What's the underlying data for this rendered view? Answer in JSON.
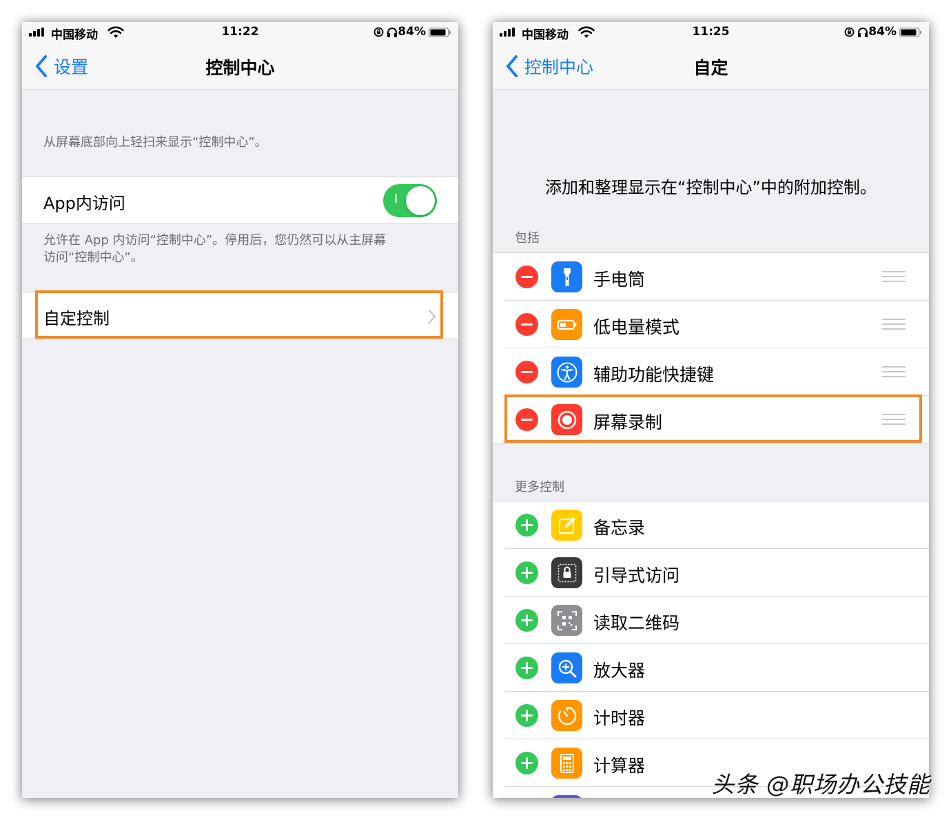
{
  "left": {
    "status": {
      "carrier": "中国移动",
      "time": "11:22",
      "battery": "84%"
    },
    "nav": {
      "back_label": "设置",
      "title": "控制中心"
    },
    "intro_text": "从屏幕底部向上轻扫来显示“控制中心”。",
    "app_access": {
      "label": "App内访问",
      "toggle_glyph": "I",
      "enabled": true
    },
    "app_access_footer_line1": "允许在 App 内访问“控制中心”。停用后，您仍然可以从主屏幕",
    "app_access_footer_line2": "访问“控制中心”。",
    "customize_label": "自定控制"
  },
  "right": {
    "status": {
      "carrier": "中国移动",
      "time": "11:25",
      "battery": "84%"
    },
    "nav": {
      "back_label": "控制中心",
      "title": "自定"
    },
    "description": "添加和整理显示在“控制中心”中的附加控制。",
    "included_header": "包括",
    "included": [
      {
        "label": "手电筒",
        "icon": "flashlight-icon",
        "color": "#1a7cf5"
      },
      {
        "label": "低电量模式",
        "icon": "battery-icon",
        "color": "#ff9500"
      },
      {
        "label": "辅助功能快捷键",
        "icon": "accessibility-icon",
        "color": "#1a7cf5"
      },
      {
        "label": "屏幕录制",
        "icon": "screen-record-icon",
        "color": "#ff3b30"
      }
    ],
    "more_header": "更多控制",
    "more": [
      {
        "label": "备忘录",
        "icon": "notes-icon",
        "color": "#ffcc00"
      },
      {
        "label": "引导式访问",
        "icon": "lock-icon",
        "color": "#3a3a3c"
      },
      {
        "label": "读取二维码",
        "icon": "qr-code-icon",
        "color": "#8e8e93"
      },
      {
        "label": "放大器",
        "icon": "magnifier-icon",
        "color": "#1a7cf5"
      },
      {
        "label": "计时器",
        "icon": "timer-icon",
        "color": "#ff9500"
      },
      {
        "label": "计算器",
        "icon": "calculator-icon",
        "color": "#ff9500"
      }
    ]
  },
  "colors": {
    "accent": "#1a7cf5",
    "toggle_on": "#34c759",
    "remove": "#ff3b30",
    "add": "#34c759",
    "highlight": "#f08a2b"
  },
  "watermark": "头条 @职场办公技能"
}
